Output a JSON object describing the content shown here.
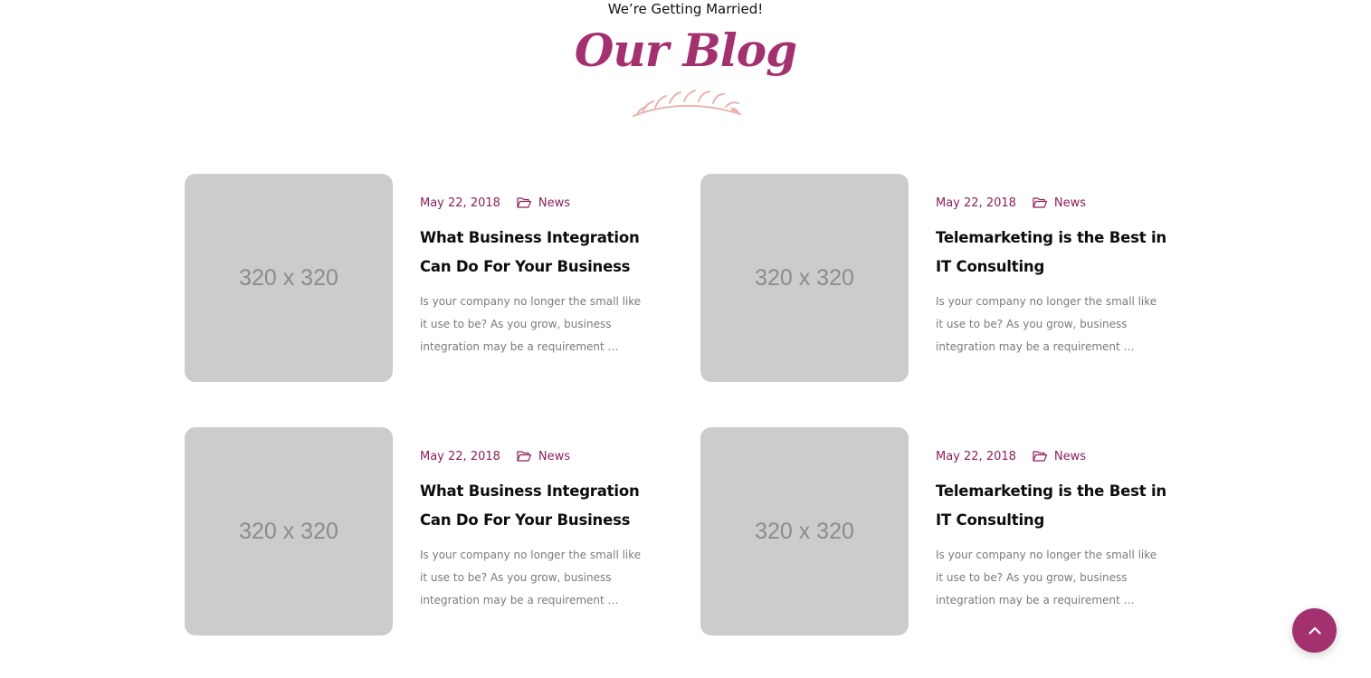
{
  "header": {
    "subtitle": "We’re Getting Married!",
    "title": "Our Blog"
  },
  "posts": [
    {
      "image_label": "320 x 320",
      "date": "May 22, 2018",
      "category": "News",
      "title": "What Business Integration Can Do For Your Business",
      "excerpt": "Is your company no longer the small like it use to be? As you grow, business integration may be a requirement …"
    },
    {
      "image_label": "320 x 320",
      "date": "May 22, 2018",
      "category": "News",
      "title": "Telemarketing is the Best in IT Consulting",
      "excerpt": "Is your company no longer the small like it use to be? As you grow, business integration may be a requirement …"
    },
    {
      "image_label": "320 x 320",
      "date": "May 22, 2018",
      "category": "News",
      "title": "What Business Integration Can Do For Your Business",
      "excerpt": "Is your company no longer the small like it use to be? As you grow, business integration may be a requirement …"
    },
    {
      "image_label": "320 x 320",
      "date": "May 22, 2018",
      "category": "News",
      "title": "Telemarketing is the Best in IT Consulting",
      "excerpt": "Is your company no longer the small like it use to be? As you grow, business integration may be a requirement …"
    }
  ],
  "icons": {
    "category": "folder-open-icon",
    "scroll_top": "chevron-up-icon",
    "divider": "leaf-branch-icon"
  },
  "colors": {
    "accent": "#a3306f",
    "meta": "#8c1f5c",
    "leaf": "#e8b4ad",
    "placeholder": "#cccccc"
  }
}
